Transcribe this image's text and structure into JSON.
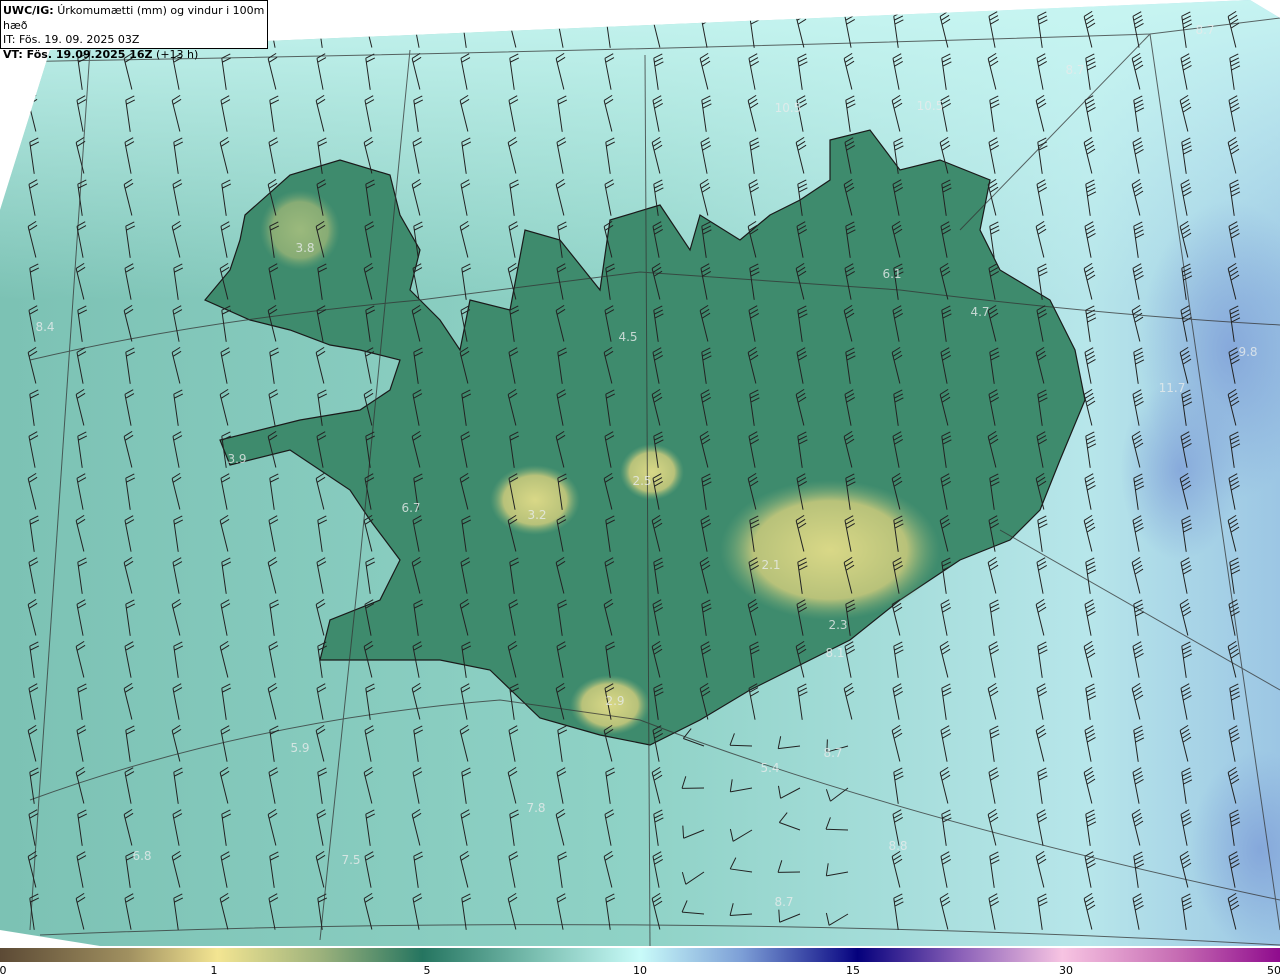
{
  "header": {
    "product": "UWC/IG:",
    "description": "Úrkomumætti (mm) og vindur i 100m hæð",
    "init_time": "IT: Fös. 19. 09. 2025 03Z",
    "valid_label": "VT: Fös. 19.09.2025 16Z",
    "lead_time": "(+13 h)"
  },
  "colorbar": {
    "ticks": [
      "0",
      "1",
      "5",
      "10",
      "15",
      "30",
      "50"
    ]
  },
  "value_labels": [
    {
      "text": "9.5",
      "lon_lat_hint": "north-ocean"
    },
    {
      "text": "10.5"
    },
    {
      "text": "10.5"
    },
    {
      "text": "8.7"
    },
    {
      "text": "8.7"
    },
    {
      "text": "3.8"
    },
    {
      "text": "8.4"
    },
    {
      "text": "6.1"
    },
    {
      "text": "4.7"
    },
    {
      "text": "4.5"
    },
    {
      "text": "9.8"
    },
    {
      "text": "11.7"
    },
    {
      "text": "3.9"
    },
    {
      "text": "2.5"
    },
    {
      "text": "6.7"
    },
    {
      "text": "3.2"
    },
    {
      "text": "2.1"
    },
    {
      "text": "2.3"
    },
    {
      "text": "8.1"
    },
    {
      "text": "2.9"
    },
    {
      "text": "5.9"
    },
    {
      "text": "5.4"
    },
    {
      "text": "8.7"
    },
    {
      "text": "7.8"
    },
    {
      "text": "8.8"
    },
    {
      "text": "6.8"
    },
    {
      "text": "7.5"
    },
    {
      "text": "8.7"
    }
  ],
  "colors": {
    "ocean_north": "#c4f0ec",
    "ocean_west": "#82c6b8",
    "ocean_east": "#a8cfe6",
    "land": "#3d8a6c",
    "glacier": "#c8c67a"
  }
}
